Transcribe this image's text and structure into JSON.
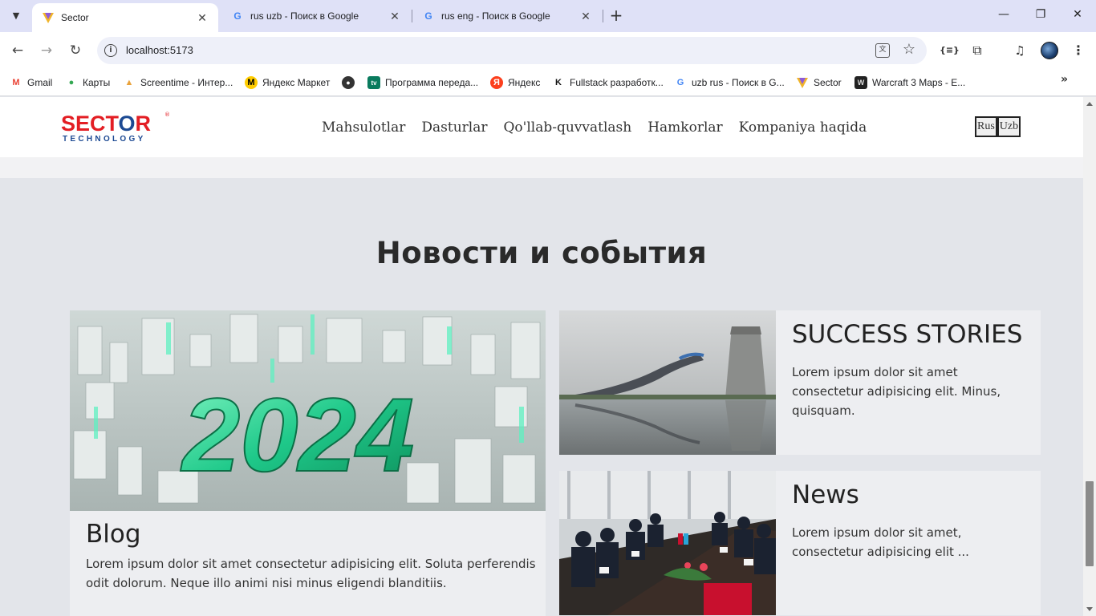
{
  "browser": {
    "tabs": [
      {
        "title": "Sector",
        "active": true
      },
      {
        "title": "rus uzb - Поиск в Google",
        "active": false
      },
      {
        "title": "rus eng - Поиск в Google",
        "active": false
      }
    ],
    "url": "localhost:5173",
    "bookmarks": [
      {
        "label": "Gmail",
        "icon": "gmail-icon"
      },
      {
        "label": "Карты",
        "icon": "maps-icon"
      },
      {
        "label": "Screentime - Интер...",
        "icon": "screentime-icon"
      },
      {
        "label": "Яндекс Маркет",
        "icon": "yandex-market-icon"
      },
      {
        "label": "",
        "icon": "globe-icon"
      },
      {
        "label": "Программа переда...",
        "icon": "tv-icon"
      },
      {
        "label": "Яндекс",
        "icon": "yandex-icon"
      },
      {
        "label": "Fullstack разработк...",
        "icon": "k-icon"
      },
      {
        "label": "uzb rus - Поиск в G...",
        "icon": "google-icon"
      },
      {
        "label": "Sector",
        "icon": "sector-icon"
      },
      {
        "label": "Warcraft 3 Maps - E...",
        "icon": "warcraft-icon"
      }
    ]
  },
  "site": {
    "logo": {
      "main": "SECT",
      "o": "O",
      "end": "R",
      "reg": "®",
      "sub": "TECHNOLOGY"
    },
    "nav": [
      "Mahsulotlar",
      "Dasturlar",
      "Qo'llab-quvvatlash",
      "Hamkorlar",
      "Kompaniya haqida"
    ],
    "lang": [
      "Rus",
      "Uzb"
    ],
    "section_title": "Новости и события",
    "blog": {
      "title": "Blog",
      "text": "Lorem ipsum dolor sit amet consectetur adipisicing elit. Soluta perferendis odit dolorum. Neque illo animi nisi minus eligendi blanditiis.",
      "image_caption": "2024"
    },
    "cards": [
      {
        "title": "SUCCESS STORIES",
        "text": "Lorem ipsum dolor sit amet consectetur adipisicing elit. Minus, quisquam."
      },
      {
        "title": "News",
        "text": "Lorem ipsum dolor sit amet, consectetur adipisicing elit ..."
      }
    ]
  }
}
